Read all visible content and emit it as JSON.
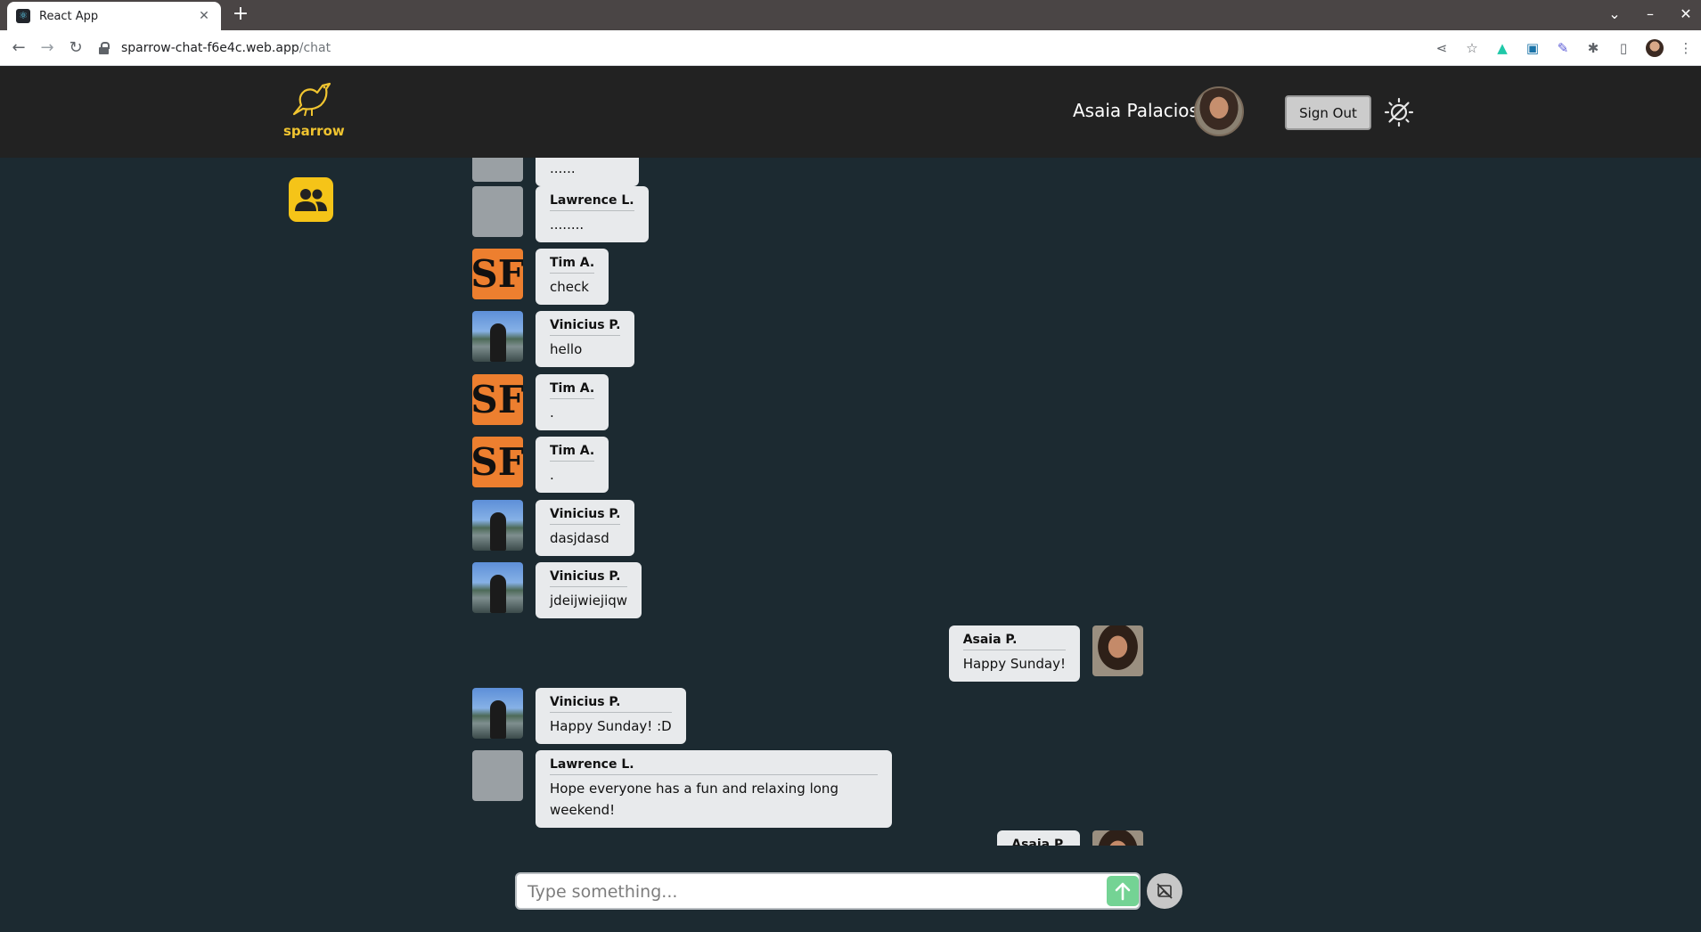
{
  "browser": {
    "tab_title": "React App",
    "tab_close": "✕",
    "new_tab": "+",
    "url_domain": "sparrow-chat-f6e4c.web.app",
    "url_path": "/chat",
    "window_controls": [
      "⌄",
      "–",
      "✕"
    ],
    "nav": {
      "back": "←",
      "forward": "→",
      "reload": "↻"
    },
    "extensions": [
      "share-icon",
      "star-icon",
      "extension-icon",
      "extension-icon",
      "extension-icon",
      "puzzle-icon",
      "sidepanel-icon",
      "profile-avatar",
      "menu-icon"
    ]
  },
  "header": {
    "logo_text": "sparrow",
    "user_name": "Asaia Palacios",
    "sign_out_label": "Sign Out"
  },
  "messages": [
    {
      "sender": "",
      "text": "......",
      "avatar": "gray",
      "side": "left"
    },
    {
      "sender": "Lawrence L.",
      "text": "........",
      "avatar": "gray",
      "side": "left"
    },
    {
      "sender": "Tim A.",
      "text": "check",
      "avatar": "sf",
      "side": "left"
    },
    {
      "sender": "Vinicius P.",
      "text": "hello",
      "avatar": "vin",
      "side": "left"
    },
    {
      "sender": "Tim A.",
      "text": ".",
      "avatar": "sf",
      "side": "left"
    },
    {
      "sender": "Tim A.",
      "text": ".",
      "avatar": "sf",
      "side": "left"
    },
    {
      "sender": "Vinicius P.",
      "text": "dasjdasd",
      "avatar": "vin",
      "side": "left"
    },
    {
      "sender": "Vinicius P.",
      "text": "jdeijwiejiqw",
      "avatar": "vin",
      "side": "left"
    },
    {
      "sender": "Asaia P.",
      "text": "Happy Sunday!",
      "avatar": "asa",
      "side": "right"
    },
    {
      "sender": "Vinicius P.",
      "text": "Happy Sunday! :D",
      "avatar": "vin",
      "side": "left"
    },
    {
      "sender": "Lawrence L.",
      "text": "Hope everyone has a fun and relaxing long weekend!",
      "avatar": "gray",
      "side": "left"
    },
    {
      "sender": "Asaia P.",
      "text": "",
      "avatar": "asa",
      "side": "right"
    }
  ],
  "sf_logo_glyph": "SF",
  "composer": {
    "placeholder": "Type something..."
  },
  "colors": {
    "background": "#1c2a31",
    "header": "#222222",
    "accent": "#f5c418",
    "bubble": "#e8eaec",
    "send": "#74d394"
  }
}
